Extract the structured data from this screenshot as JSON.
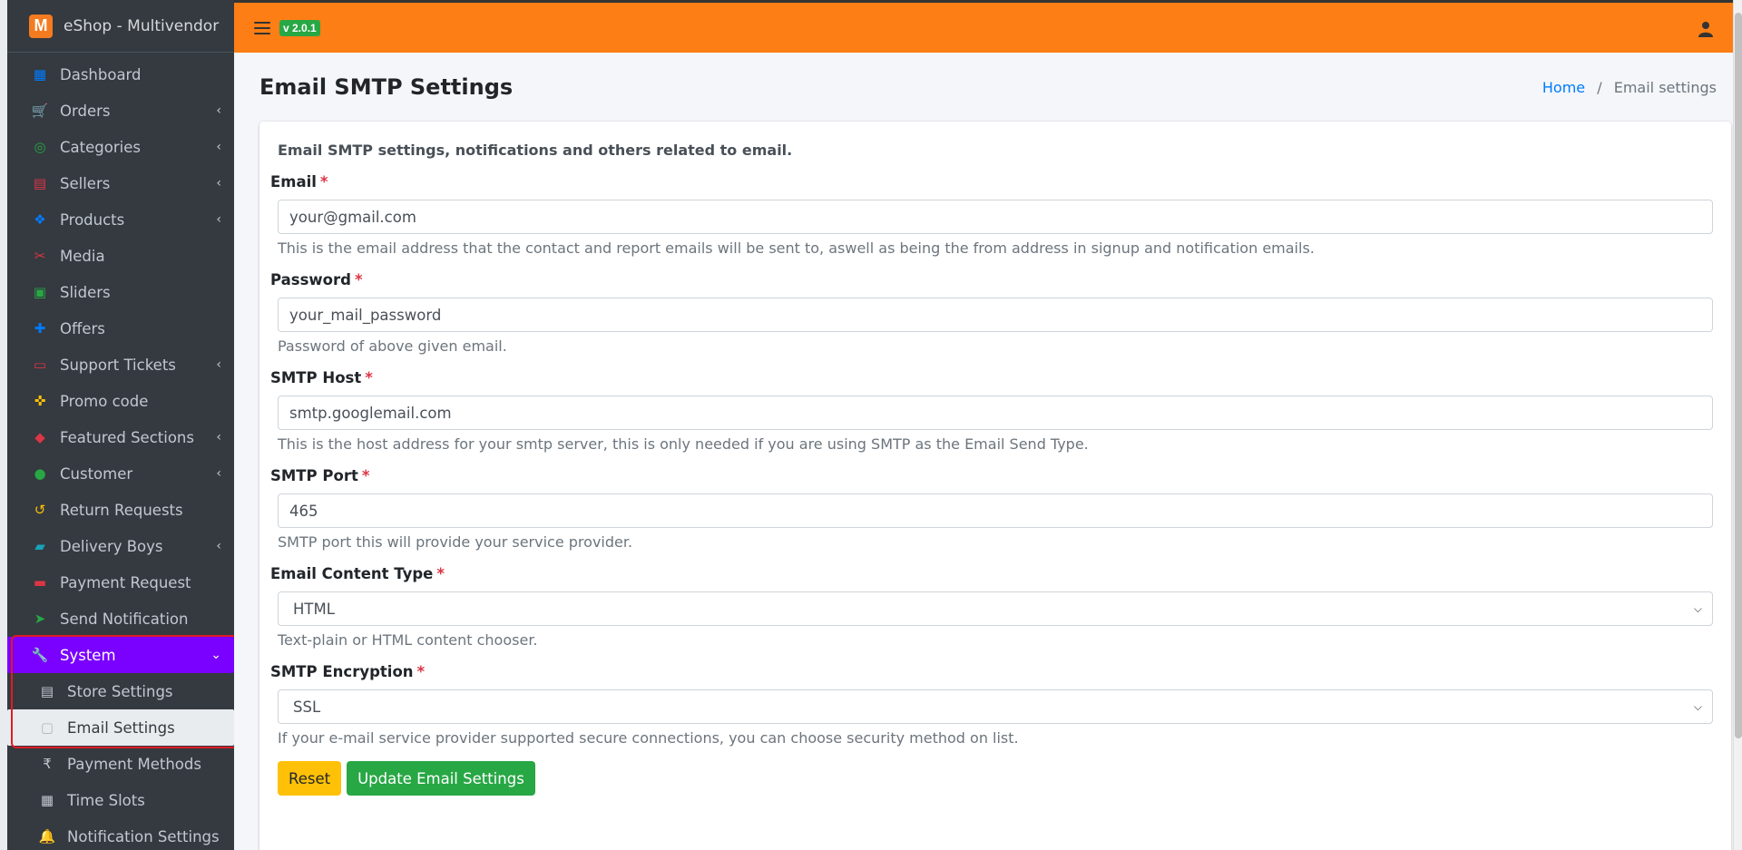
{
  "app": {
    "brand": "eShop - Multivendor",
    "logo_letter": "M",
    "version": "v 2.0.1"
  },
  "sidebar": {
    "items": [
      {
        "label": "Dashboard",
        "icon": "dashboard-icon",
        "color": "#007bff",
        "glyph": "▦",
        "expandable": false
      },
      {
        "label": "Orders",
        "icon": "cart-icon",
        "color": "#ffc107",
        "glyph": "🛒",
        "expandable": true
      },
      {
        "label": "Categories",
        "icon": "target-icon",
        "color": "#28a745",
        "glyph": "◎",
        "expandable": true
      },
      {
        "label": "Sellers",
        "icon": "store-icon",
        "color": "#dc3545",
        "glyph": "▤",
        "expandable": true
      },
      {
        "label": "Products",
        "icon": "cubes-icon",
        "color": "#007bff",
        "glyph": "❖",
        "expandable": true
      },
      {
        "label": "Media",
        "icon": "media-icon",
        "color": "#dc3545",
        "glyph": "✂",
        "expandable": false
      },
      {
        "label": "Sliders",
        "icon": "image-icon",
        "color": "#28a745",
        "glyph": "▣",
        "expandable": false
      },
      {
        "label": "Offers",
        "icon": "gift-icon",
        "color": "#007bff",
        "glyph": "✚",
        "expandable": false
      },
      {
        "label": "Support Tickets",
        "icon": "ticket-icon",
        "color": "#dc3545",
        "glyph": "▭",
        "expandable": true
      },
      {
        "label": "Promo code",
        "icon": "puzzle-icon",
        "color": "#ffc107",
        "glyph": "✜",
        "expandable": false
      },
      {
        "label": "Featured Sections",
        "icon": "layers-icon",
        "color": "#dc3545",
        "glyph": "◆",
        "expandable": true
      },
      {
        "label": "Customer",
        "icon": "user-icon",
        "color": "#28a745",
        "glyph": "●",
        "expandable": true
      },
      {
        "label": "Return Requests",
        "icon": "undo-icon",
        "color": "#ffc107",
        "glyph": "↺",
        "expandable": false
      },
      {
        "label": "Delivery Boys",
        "icon": "id-badge-icon",
        "color": "#17a2b8",
        "glyph": "▰",
        "expandable": true
      },
      {
        "label": "Payment Request",
        "icon": "money-icon",
        "color": "#dc3545",
        "glyph": "▬",
        "expandable": false
      },
      {
        "label": "Send Notification",
        "icon": "paper-plane-icon",
        "color": "#28a745",
        "glyph": "➤",
        "expandable": false
      },
      {
        "label": "System",
        "icon": "wrench-icon",
        "color": "#ffffff",
        "glyph": "🔧",
        "expandable": true,
        "active": true
      },
      {
        "label": "Store Settings",
        "icon": "store-settings-icon",
        "color": "#c2c7d0",
        "glyph": "▤",
        "sub": true
      },
      {
        "label": "Email Settings",
        "icon": "email-settings-icon",
        "color": "#adb5bd",
        "glyph": "▢",
        "sub": true,
        "active": true
      },
      {
        "label": "Payment Methods",
        "icon": "rupee-icon",
        "color": "#c2c7d0",
        "glyph": "₹",
        "sub": true
      },
      {
        "label": "Time Slots",
        "icon": "calendar-icon",
        "color": "#c2c7d0",
        "glyph": "▦",
        "sub": true
      },
      {
        "label": "Notification Settings",
        "icon": "bell-icon",
        "color": "#c2c7d0",
        "glyph": "🔔",
        "sub": true
      }
    ]
  },
  "header": {
    "title": "Email SMTP Settings",
    "breadcrumb_home": "Home",
    "breadcrumb_sep": "/",
    "breadcrumb_current": "Email settings"
  },
  "form": {
    "description": "Email SMTP settings, notifications and others related to email.",
    "required_mark": "*",
    "email": {
      "label": "Email",
      "value": "your@gmail.com",
      "help": "This is the email address that the contact and report emails will be sent to, aswell as being the from address in signup and notification emails."
    },
    "password": {
      "label": "Password",
      "value": "your_mail_password",
      "help": "Password of above given email."
    },
    "smtp_host": {
      "label": "SMTP Host",
      "value": "smtp.googlemail.com",
      "help": "This is the host address for your smtp server, this is only needed if you are using SMTP as the Email Send Type."
    },
    "smtp_port": {
      "label": "SMTP Port",
      "value": "465",
      "help": "SMTP port this will provide your service provider."
    },
    "content_type": {
      "label": "Email Content Type",
      "value": "HTML",
      "help": "Text-plain or HTML content chooser."
    },
    "encryption": {
      "label": "SMTP Encryption",
      "value": "SSL",
      "help": "If your e-mail service provider supported secure connections, you can choose security method on list."
    },
    "reset_label": "Reset",
    "update_label": "Update Email Settings"
  },
  "colors": {
    "topbar": "#fd7e14",
    "sidebar": "#343a40",
    "active": "#7a00ff",
    "accent": "#28a745"
  }
}
